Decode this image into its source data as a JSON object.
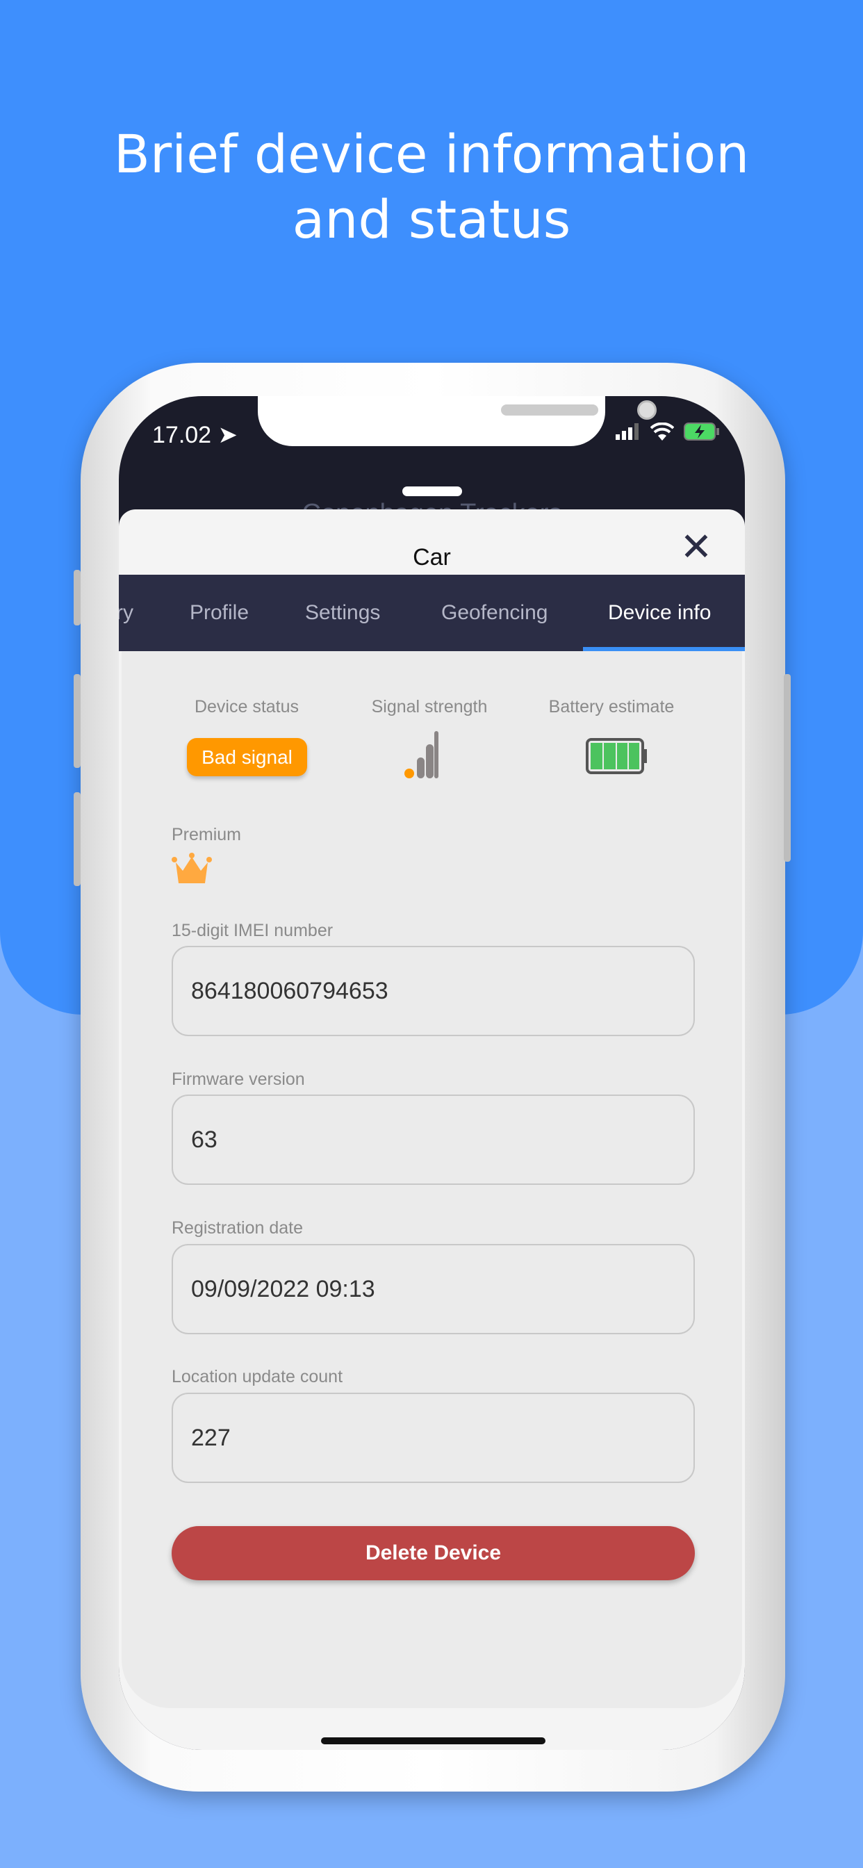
{
  "headline": [
    "Brief device information",
    "and status"
  ],
  "status_bar": {
    "time": "17.02"
  },
  "background_title": "Copenhagen Trackers",
  "sheet": {
    "title": "Car",
    "close_icon": "close-icon"
  },
  "tabs": [
    {
      "label": "ry"
    },
    {
      "label": "Profile"
    },
    {
      "label": "Settings"
    },
    {
      "label": "Geofencing"
    },
    {
      "label": "Device info",
      "active": true
    }
  ],
  "status": {
    "device_status_label": "Device status",
    "device_status": "Bad signal",
    "signal_label": "Signal strength",
    "signal_bars_active": 1,
    "signal_bars_total": 4,
    "battery_label": "Battery estimate",
    "battery_segments_filled": 4,
    "battery_segments_total": 4
  },
  "premium": {
    "label": "Premium",
    "icon": "crown-icon"
  },
  "fields": [
    {
      "label": "15-digit IMEI number",
      "value": "864180060794653"
    },
    {
      "label": "Firmware version",
      "value": "63"
    },
    {
      "label": "Registration date",
      "value": "09/09/2022 09:13"
    },
    {
      "label": "Location update count",
      "value": "227"
    }
  ],
  "delete_button": "Delete Device",
  "colors": {
    "bg_top": "#3e8ffd",
    "bg_bottom": "#7cb0fd",
    "badge": "#ff9800",
    "delete": "#bc4646",
    "tab_bar": "#2b2d45",
    "tab_indicator": "#3a8ff5",
    "battery": "#4cc35e"
  }
}
